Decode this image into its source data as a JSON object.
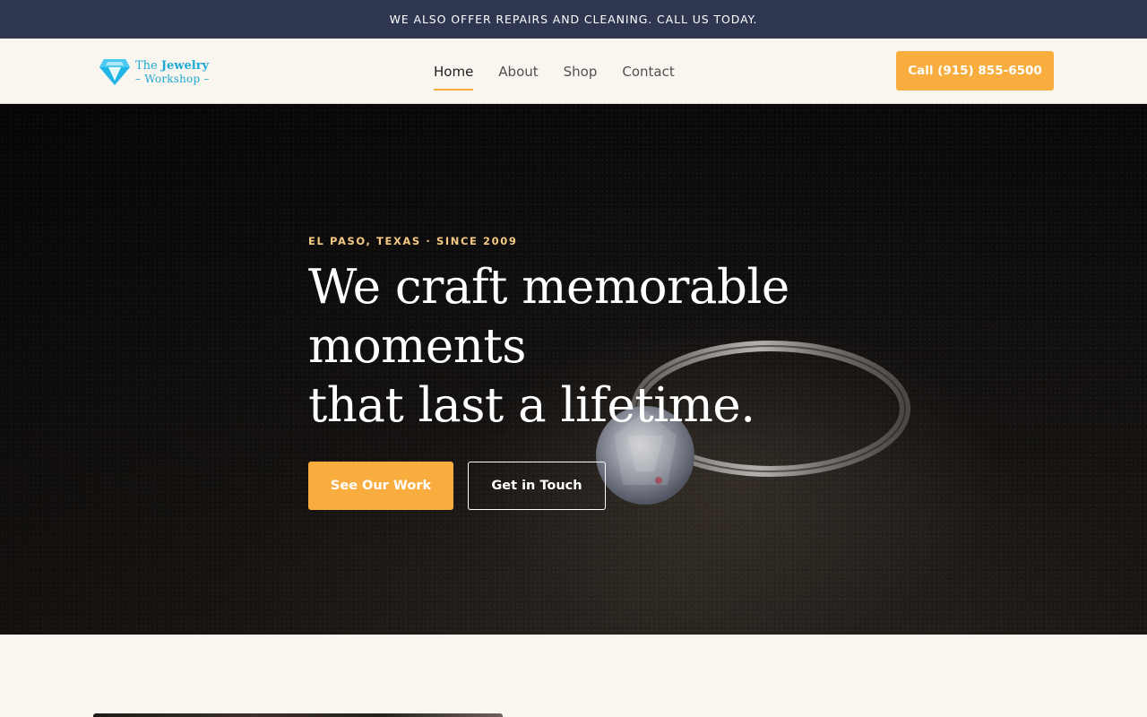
{
  "announcement": {
    "text": "WE ALSO OFFER REPAIRS AND CLEANING. CALL US TODAY."
  },
  "header": {
    "logo": {
      "line1_prefix": "The ",
      "line1_bold": "Jewelry",
      "line2": "– Workshop –",
      "icon": "diamond-icon",
      "color": "#1fa9d6"
    },
    "nav": [
      {
        "label": "Home",
        "active": true
      },
      {
        "label": "About",
        "active": false
      },
      {
        "label": "Shop",
        "active": false
      },
      {
        "label": "Contact",
        "active": false
      }
    ],
    "call_button": "Call (915) 855-6500"
  },
  "hero": {
    "eyebrow": "EL PASO, TEXAS · SINCE 2009",
    "headline_lines": [
      "We craft memorable",
      "moments",
      "that last a lifetime."
    ],
    "primary_button": "See Our Work",
    "secondary_button": "Get in Touch",
    "background_image": "ring-on-sand-photo"
  },
  "colors": {
    "accent": "#f9ad3e",
    "announce_bg": "#2f3650",
    "page_bg": "#f9f6ef",
    "eyebrow": "#f5c983"
  }
}
